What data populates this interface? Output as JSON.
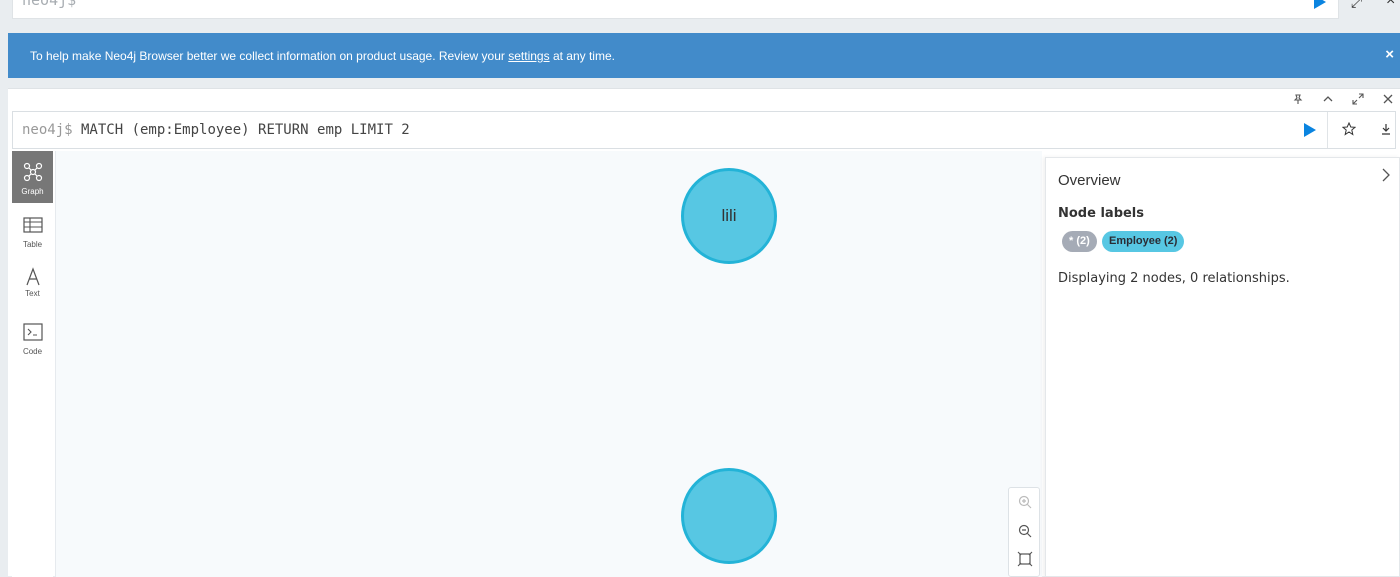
{
  "top_editor": {
    "prompt": "neo4j$"
  },
  "banner": {
    "text_before": "To help make Neo4j Browser better we collect information on product usage. Review your ",
    "link": "settings",
    "text_after": " at any time.",
    "close": "×"
  },
  "frame": {
    "editor": {
      "prompt": "neo4j$",
      "query": " MATCH (emp:Employee) RETURN emp LIMIT 2"
    },
    "nav": [
      {
        "label": "Graph",
        "icon": "graph-icon",
        "active": true
      },
      {
        "label": "Table",
        "icon": "table-icon"
      },
      {
        "label": "Text",
        "icon": "text-icon"
      },
      {
        "label": "Code",
        "icon": "code-icon"
      }
    ],
    "nodes": [
      {
        "caption": "lili"
      },
      {
        "caption": ""
      }
    ]
  },
  "overview": {
    "title": "Overview",
    "node_labels_heading": "Node labels",
    "labels": [
      {
        "text": "* (2)",
        "color": "#a5abb6"
      },
      {
        "text": "Employee (2)",
        "color": "#57c7e3"
      }
    ],
    "summary": "Displaying 2 nodes, 0 relationships."
  },
  "colors": {
    "banner": "#428bca",
    "node_fill": "#57c7e3",
    "node_border": "#23b3d7",
    "run_button": "#0a84e0"
  }
}
